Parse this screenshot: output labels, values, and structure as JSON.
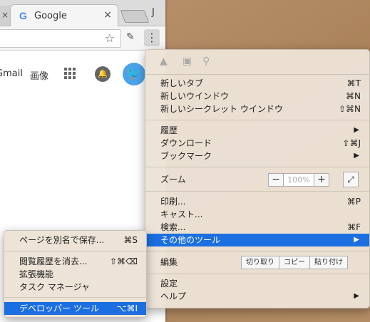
{
  "browser": {
    "prev_tab_close": "×",
    "tab_title": "Google",
    "tab_icon": "G",
    "tab_close": "×",
    "profile_initial": "J",
    "gbar": {
      "gmail": "Gmail",
      "images": "画像"
    }
  },
  "main_menu": {
    "items": [
      {
        "label": "新しいタブ",
        "shortcut": "⌘T"
      },
      {
        "label": "新しいウインドウ",
        "shortcut": "⌘N"
      },
      {
        "label": "新しいシークレット ウインドウ",
        "shortcut": "⇧⌘N"
      },
      {
        "label": "履歴",
        "arrow": "▶"
      },
      {
        "label": "ダウンロード",
        "shortcut": "⇧⌘J"
      },
      {
        "label": "ブックマーク",
        "arrow": "▶"
      },
      {
        "label": "印刷...",
        "shortcut": "⌘P"
      },
      {
        "label": "キャスト..."
      },
      {
        "label": "検索...",
        "shortcut": "⌘F"
      },
      {
        "label": "その他のツール",
        "arrow": "▶"
      },
      {
        "label": "設定"
      },
      {
        "label": "ヘルプ",
        "arrow": "▶"
      }
    ],
    "zoom": {
      "label": "ズーム",
      "minus": "−",
      "value": "100%",
      "plus": "+",
      "fullscreen": "⤢"
    },
    "edit": {
      "label": "編集",
      "cut": "切り取り",
      "copy": "コピー",
      "paste": "貼り付け"
    }
  },
  "sub_menu": {
    "items": [
      {
        "label": "ページを別名で保存...",
        "shortcut": "⌘S"
      },
      {
        "label": "閲覧履歴を消去...",
        "shortcut": "⇧⌘⌫"
      },
      {
        "label": "拡張機能"
      },
      {
        "label": "タスク マネージャ"
      },
      {
        "label": "デベロッパー ツール",
        "shortcut": "⌥⌘I"
      }
    ]
  },
  "colors": {
    "highlight": "#1b6fe0",
    "menu_bg": "#ece2d6",
    "twitter": "#4aa3ea"
  }
}
